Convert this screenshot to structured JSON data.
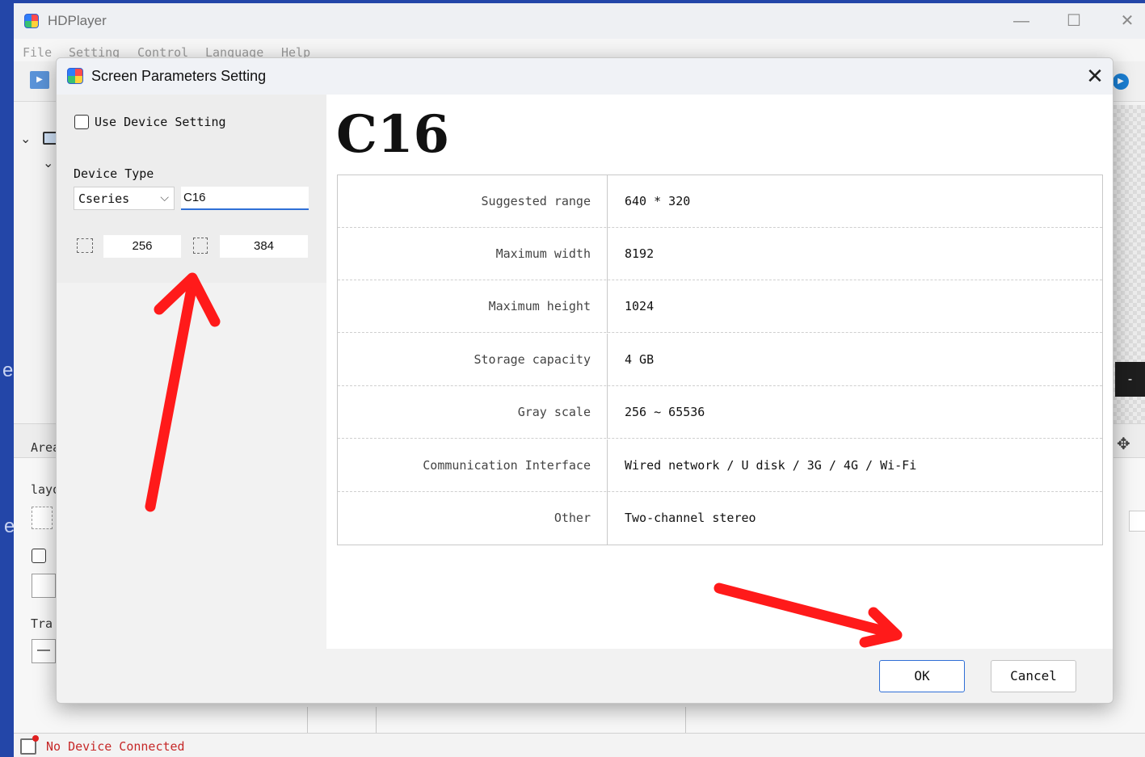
{
  "app": {
    "title": "HDPlayer",
    "menu": [
      "File",
      "Setting",
      "Control",
      "Language",
      "Help"
    ],
    "left_labels": {
      "area": "Area",
      "layout": "layout",
      "transparency": "Tra"
    },
    "status": "No Device Connected"
  },
  "dialog": {
    "title": "Screen Parameters Setting",
    "use_device_setting_label": "Use Device Setting",
    "device_type_label": "Device Type",
    "device_series": "Cseries",
    "device_model": "C16",
    "width_value": "256",
    "height_value": "384",
    "model_heading": "C16",
    "specs": [
      {
        "label": "Suggested range",
        "value": "640 * 320"
      },
      {
        "label": "Maximum width",
        "value": "8192"
      },
      {
        "label": "Maximum height",
        "value": "1024"
      },
      {
        "label": "Storage capacity",
        "value": "4 GB"
      },
      {
        "label": "Gray scale",
        "value": "256 ~ 65536"
      },
      {
        "label": "Communication Interface",
        "value": "Wired network / U disk / 3G / 4G / Wi-Fi"
      },
      {
        "label": "Other",
        "value": "Two-channel stereo"
      }
    ],
    "ok_label": "OK",
    "cancel_label": "Cancel"
  },
  "colors": {
    "desktop": "#2346a8",
    "accent": "#2f6fd6",
    "annotation": "#ff1a1a",
    "status_error": "#c62828"
  }
}
